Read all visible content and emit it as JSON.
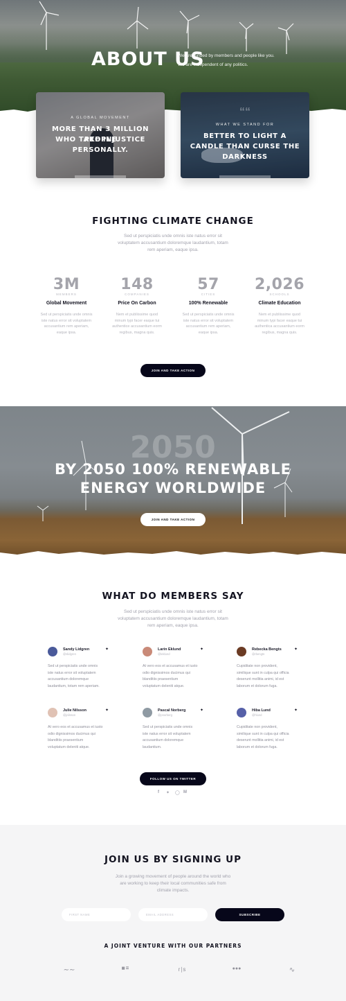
{
  "hero": {
    "title": "ABOUT US",
    "sub_line1": "We are funded by members and people like you.",
    "sub_line2": "We are independent of any politics."
  },
  "cards": [
    {
      "tag": "A GLOBAL MOVEMENT",
      "title_l1": "MORE THAN 3 MILLION PEOPLE",
      "title_l2": "WHO TAKE INJUSTICE",
      "title_l3": "PERSONALLY."
    },
    {
      "tag": "WHAT WE STAND FOR",
      "title_l1": "BETTER TO LIGHT A",
      "title_l2": "CANDLE THAN CURSE THE",
      "title_l3": "DARKNESS"
    }
  ],
  "climate": {
    "title": "FIGHTING CLIMATE CHANGE",
    "desc_l1": "Sed ut perspiciatis unde omnis iste natus error sit",
    "desc_l2": "voluptatem accusantium doloremque laudantium, totam",
    "desc_l3": "rem aperiam, eaque ipsa.",
    "stats": [
      {
        "num": "3M",
        "unit": "MEMBERS",
        "label": "Global Movement",
        "t1": "Sed ut perspiciatis unde omnis",
        "t2": "iste natus error sit voluptatem",
        "t3": "accusantium rem aperiam,",
        "t4": "eaque ipsa."
      },
      {
        "num": "148",
        "unit": "COMPANIES",
        "label": "Price On Carbon",
        "t1": "Nem et publiissime quod",
        "t2": "minum typi facer eaque tui",
        "t3": "authentice accusantium eorm",
        "t4": "regibus, magna quis."
      },
      {
        "num": "57",
        "unit": "CITIES",
        "label": "100% Renewable",
        "t1": "Sed ut perspiciatis unde omnis",
        "t2": "iste natus error sit voluptatem",
        "t3": "accusantium rem aperiam,",
        "t4": "eaque ipsa."
      },
      {
        "num": "2,026",
        "unit": "SCHOOLS",
        "label": "Climate Education",
        "t1": "Nem et publiissime quod",
        "t2": "minum typi facer eaque tui",
        "t3": "authentica accusantium eorm",
        "t4": "regibus, magna quis."
      }
    ],
    "cta": "JOIN AND TAKE ACTION"
  },
  "banner": {
    "big": "2050",
    "title_l1": "BY 2050 100% RENEWABLE",
    "title_l2": "ENERGY WORLDWIDE",
    "cta": "JOIN AND TAKE ACTION"
  },
  "members": {
    "title": "WHAT DO MEMBERS SAY",
    "desc_l1": "Sed ut perspiciatis unde omnis iste natus error sit",
    "desc_l2": "voluptatem accusantium doloremque laudantium, totam",
    "desc_l3": "rem aperiam, eaque ipsa.",
    "items": [
      {
        "name": "Sandy Lidgren",
        "handle": "@slidgren",
        "b1": "Sed ut perspiciatis unde omnis",
        "b2": "iste natus error sit voluptatem",
        "b3": "accusantium doloremque",
        "b4": "laudantium, totam rem aperiam.",
        "av": "#4a5a9a"
      },
      {
        "name": "Larin Eklund",
        "handle": "@leklund",
        "b1": "At vero eos et accusamus et iusto",
        "b2": "odio dignissimos ducimus qui",
        "b3": "blanditiis praesentium",
        "b4": "voluptatum deleniti atque.",
        "av": "#c98a78"
      },
      {
        "name": "Rebecka Bengts",
        "handle": "@rbengts",
        "b1": "Cupiditate non provident,",
        "b2": "similique sunt in culpa qui officia",
        "b3": "deserunt mollitia animi, id est",
        "b4": "laborum et dolorum fuga.",
        "av": "#6b3b24"
      },
      {
        "name": "Julie Nilsson",
        "handle": "@jnilsson",
        "b1": "At vero eos et accusamus et iusto",
        "b2": "odio dignissimos ducimus qui",
        "b3": "blanditiis praesentium",
        "b4": "voluptatum deleniti atque.",
        "av": "#e0c2b4"
      },
      {
        "name": "Pascal Norberg",
        "handle": "@pnorberg",
        "b1": "Sed ut perspiciatis unde omnis",
        "b2": "iste natus error sit voluptatem",
        "b3": "accusantium doloremque",
        "b4": "laudantium.",
        "av": "#8f9aa3"
      },
      {
        "name": "Hiba Lund",
        "handle": "@hlund",
        "b1": "Cupiditate non provident,",
        "b2": "similique sunt in culpa qui officia",
        "b3": "deserunt mollitia animi, id est",
        "b4": "laborum et dolorum fuga.",
        "av": "#5660a8"
      }
    ],
    "cta": "FOLLOW US ON TWITTER",
    "social": [
      "facebook-icon",
      "twitter-icon",
      "instagram-icon",
      "medium-icon"
    ]
  },
  "signup": {
    "title": "JOIN US BY SIGNING UP",
    "desc_l1": "Join a growing movement of people around the world who",
    "desc_l2": "are working to keep their local communities safe from",
    "desc_l3": "climate impacts.",
    "first_name_placeholder": "FIRST NAME",
    "email_placeholder": "EMAIL ADDRESS",
    "subscribe": "SUBSCRIBE",
    "partners_title": "A JOINT VENTURE WITH OUR PARTNERS"
  }
}
